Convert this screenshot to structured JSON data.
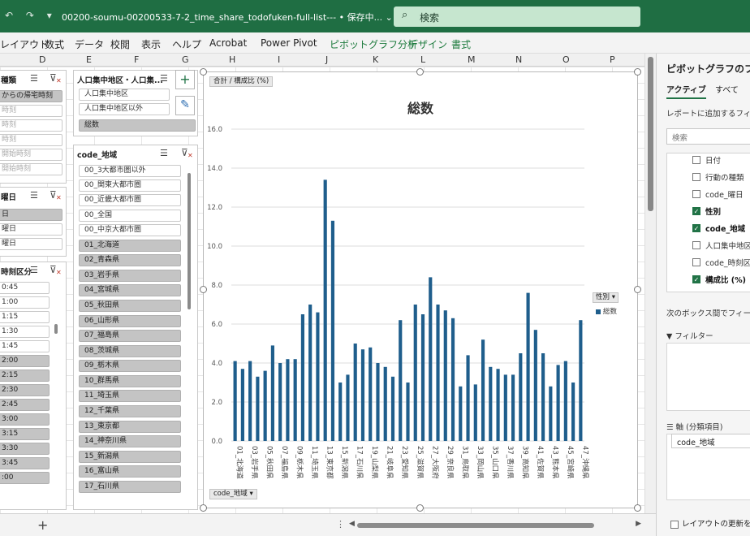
{
  "titlebar": {
    "qat_glyphs": "↶ ↷ ▾",
    "document_title": "00200-soumu-00200533-7-2_time_share_todofuken-full-list---",
    "save_status": "• 保存中... ⌄",
    "search_placeholder": "検索"
  },
  "ribbon": {
    "tabs": [
      "レイアウト",
      "数式",
      "データ",
      "校閲",
      "表示",
      "ヘルプ",
      "Acrobat",
      "Power Pivot"
    ],
    "context_tabs": [
      "ピボットグラフ分析",
      "デザイン",
      "書式"
    ]
  },
  "columns": [
    "D",
    "E",
    "F",
    "G",
    "H",
    "I",
    "J",
    "K",
    "L",
    "M",
    "N",
    "O",
    "P"
  ],
  "slicers": {
    "kind": {
      "header": "種類",
      "items": [
        {
          "label": "からの帰宅時刻",
          "selected": true
        },
        {
          "label": "時刻",
          "selected": false
        },
        {
          "label": "時刻",
          "selected": false
        },
        {
          "label": "時刻",
          "selected": false
        },
        {
          "label": "開始時刻",
          "selected": false
        },
        {
          "label": "開始時刻",
          "selected": false
        }
      ]
    },
    "dayofweek": {
      "header": "曜日",
      "items": [
        {
          "label": "日",
          "selected": true
        },
        {
          "label": "曜日",
          "selected": false
        },
        {
          "label": "曜日",
          "selected": false
        }
      ]
    },
    "timeslot": {
      "header": "時刻区分",
      "items": [
        {
          "label": "0:45",
          "selected": false
        },
        {
          "label": "1:00",
          "selected": false
        },
        {
          "label": "1:15",
          "selected": false
        },
        {
          "label": "1:30",
          "selected": false
        },
        {
          "label": "1:45",
          "selected": false
        },
        {
          "label": "2:00",
          "selected": true
        },
        {
          "label": "2:15",
          "selected": true
        },
        {
          "label": "2:30",
          "selected": true
        },
        {
          "label": "2:45",
          "selected": true
        },
        {
          "label": "3:00",
          "selected": true
        },
        {
          "label": "3:15",
          "selected": true
        },
        {
          "label": "3:30",
          "selected": true
        },
        {
          "label": "3:45",
          "selected": true
        },
        {
          "label": ":00",
          "selected": true
        }
      ]
    },
    "did": {
      "header": "人口集中地区・人口集...",
      "items": [
        {
          "label": "人口集中地区",
          "selected": false
        },
        {
          "label": "人口集中地区以外",
          "selected": false
        },
        {
          "label": "総数",
          "selected": true
        }
      ]
    },
    "region": {
      "header": "code_地域",
      "items": [
        {
          "label": "00_3大都市圏以外",
          "selected": false
        },
        {
          "label": "00_関東大都市圏",
          "selected": false
        },
        {
          "label": "00_近畿大都市圏",
          "selected": false
        },
        {
          "label": "00_全国",
          "selected": false
        },
        {
          "label": "00_中京大都市圏",
          "selected": false
        },
        {
          "label": "01_北海道",
          "selected": true
        },
        {
          "label": "02_青森県",
          "selected": true
        },
        {
          "label": "03_岩手県",
          "selected": true
        },
        {
          "label": "04_宮城県",
          "selected": true
        },
        {
          "label": "05_秋田県",
          "selected": true
        },
        {
          "label": "06_山形県",
          "selected": true
        },
        {
          "label": "07_福島県",
          "selected": true
        },
        {
          "label": "08_茨城県",
          "selected": true
        },
        {
          "label": "09_栃木県",
          "selected": true
        },
        {
          "label": "10_群馬県",
          "selected": true
        },
        {
          "label": "11_埼玉県",
          "selected": true
        },
        {
          "label": "12_千葉県",
          "selected": true
        },
        {
          "label": "13_東京都",
          "selected": true
        },
        {
          "label": "14_神奈川県",
          "selected": true
        },
        {
          "label": "15_新潟県",
          "selected": true
        },
        {
          "label": "16_富山県",
          "selected": true
        },
        {
          "label": "17_石川県",
          "selected": true
        }
      ]
    }
  },
  "chart": {
    "value_button": "合計 / 構成比 (%)",
    "axis_button": "code_地域",
    "legend_button": "性別"
  },
  "chart_data": {
    "type": "bar",
    "title": "総数",
    "ylim": [
      0,
      16
    ],
    "yticks": [
      "0.0",
      "2.0",
      "4.0",
      "6.0",
      "8.0",
      "10.0",
      "12.0",
      "14.0",
      "16.0"
    ],
    "grid": true,
    "legend_position": "right",
    "color": "#1f5e8c",
    "categories": [
      "01_北海道",
      "02_青森県",
      "03_岩手県",
      "04_宮城県",
      "05_秋田県",
      "06_山形県",
      "07_福島県",
      "08_茨城県",
      "09_栃木県",
      "10_群馬県",
      "11_埼玉県",
      "12_千葉県",
      "13_東京都",
      "14_神奈川県",
      "15_新潟県",
      "16_富山県",
      "17_石川県",
      "18_福井県",
      "19_山梨県",
      "20_長野県",
      "21_岐阜県",
      "22_静岡県",
      "23_愛知県",
      "24_三重県",
      "25_滋賀県",
      "26_京都府",
      "27_大阪府",
      "28_兵庫県",
      "29_奈良県",
      "30_和歌山県",
      "31_鳥取県",
      "32_島根県",
      "33_岡山県",
      "34_広島県",
      "35_山口県",
      "36_徳島県",
      "37_香川県",
      "38_愛媛県",
      "39_高知県",
      "40_福岡県",
      "41_佐賀県",
      "42_長崎県",
      "43_熊本県",
      "44_大分県",
      "45_宮崎県",
      "46_鹿児島県",
      "47_沖縄県"
    ],
    "xticks_shown": [
      "01_北海道",
      "03_岩手県",
      "05_秋田県",
      "07_福島県",
      "09_栃木県",
      "11_埼玉県",
      "13_東京都",
      "15_新潟県",
      "17_石川県",
      "19_山梨県",
      "21_岐阜県",
      "23_愛知県",
      "25_滋賀県",
      "27_大阪府",
      "29_奈良県",
      "31_鳥取県",
      "33_岡山県",
      "35_山口県",
      "37_香川県",
      "39_高知県",
      "41_佐賀県",
      "43_熊本県",
      "45_宮崎県",
      "47_沖縄県"
    ],
    "series": [
      {
        "name": "総数",
        "values": [
          4.1,
          3.7,
          4.1,
          3.3,
          3.6,
          4.9,
          4.0,
          4.2,
          4.2,
          6.5,
          7.0,
          6.6,
          13.4,
          11.3,
          3.0,
          3.4,
          5.0,
          4.7,
          4.8,
          4.0,
          3.8,
          3.3,
          6.2,
          3.0,
          7.0,
          6.5,
          8.4,
          7.0,
          6.7,
          6.3,
          2.8,
          4.4,
          2.9,
          5.2,
          3.8,
          3.7,
          3.4,
          3.4,
          4.5,
          7.6,
          5.7,
          4.5,
          2.8,
          3.9,
          4.1,
          3.0,
          6.2
        ]
      }
    ]
  },
  "pane": {
    "title": "ピボットグラフのフィールド",
    "tabs": [
      "アクティブ",
      "すべて"
    ],
    "instruction": "レポートに追加するフィールド",
    "search_placeholder": "検索",
    "fields": [
      {
        "label": "日付",
        "checked": false
      },
      {
        "label": "行動の種類",
        "checked": false
      },
      {
        "label": "code_曜日",
        "checked": false
      },
      {
        "label": "性別",
        "checked": true
      },
      {
        "label": "code_地域",
        "checked": true
      },
      {
        "label": "人口集中地区",
        "checked": false
      },
      {
        "label": "code_時刻区",
        "checked": false
      },
      {
        "label": "構成比 (%)",
        "checked": true
      }
    ],
    "drag_hint": "次のボックス間でフィールド",
    "filter_label": "フィルター",
    "axis_label": "軸 (分類項目)",
    "axis_item": "code_地域",
    "defer_update_label": "レイアウトの更新を保"
  },
  "statusbar": {
    "add_sheet": "+",
    "dots": "⋮"
  }
}
